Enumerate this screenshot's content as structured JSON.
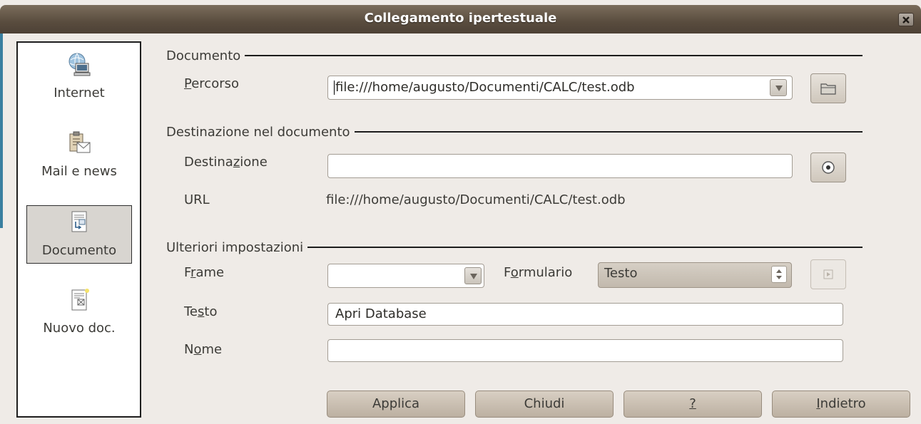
{
  "window": {
    "title": "Collegamento ipertestuale"
  },
  "nav": {
    "items": [
      {
        "label": "Internet",
        "icon": "globe-computer-icon"
      },
      {
        "label": "Mail e news",
        "icon": "mail-clipboard-icon"
      },
      {
        "label": "Documento",
        "icon": "document-icon",
        "selected": true
      },
      {
        "label": "Nuovo doc.",
        "icon": "new-document-icon"
      }
    ]
  },
  "documento": {
    "section_label": "Documento",
    "percorso_label_pre": "",
    "percorso_label_mn": "P",
    "percorso_label_post": "ercorso",
    "percorso_value": "file:///home/augusto/Documenti/CALC/test.odb"
  },
  "destinazione": {
    "section_label": "Destinazione nel documento",
    "destinazione_label_pre": "Destina",
    "destinazione_label_mn": "z",
    "destinazione_label_post": "ione",
    "destinazione_value": "",
    "url_label": "URL",
    "url_value": "file:///home/augusto/Documenti/CALC/test.odb"
  },
  "ulteriori": {
    "section_label": "Ulteriori impostazioni",
    "frame_label_pre": "F",
    "frame_label_mn": "r",
    "frame_label_post": "ame",
    "frame_value": "",
    "formulario_label_pre": "F",
    "formulario_label_mn": "o",
    "formulario_label_post": "rmulario",
    "formulario_value": "Testo",
    "testo_label_pre": "Te",
    "testo_label_mn": "s",
    "testo_label_post": "to",
    "testo_value": "Apri Database",
    "nome_label_pre": "N",
    "nome_label_mn": "o",
    "nome_label_post": "me",
    "nome_value": ""
  },
  "buttons": {
    "applica": "Applica",
    "chiudi": "Chiudi",
    "help": "?",
    "indietro_mn": "I",
    "indietro_rest": "ndietro"
  }
}
